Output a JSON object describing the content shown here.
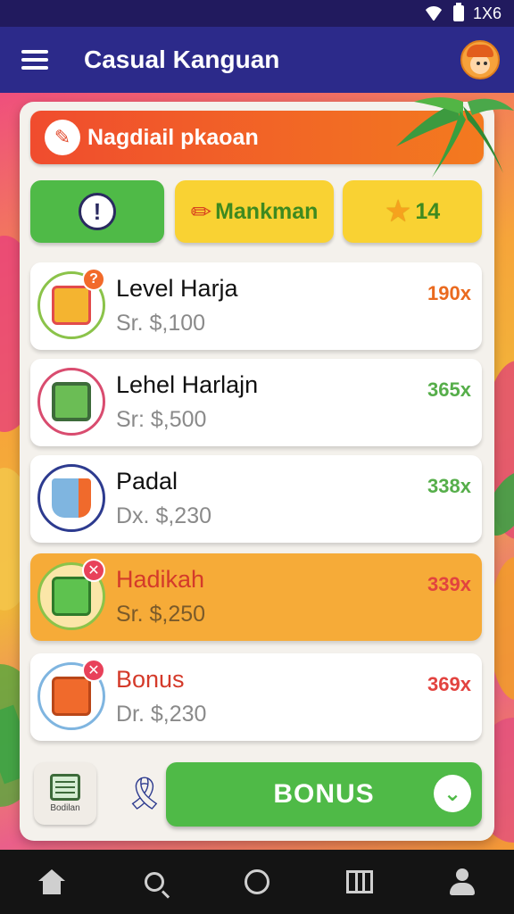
{
  "status_bar": {
    "time": "1X6"
  },
  "app_bar": {
    "title": "Casual Kanguan"
  },
  "banner": {
    "title": "Nagdiail pkaoan"
  },
  "chips": [
    {
      "icon": "alert-icon",
      "label": ""
    },
    {
      "icon": "pencil-icon",
      "label": "Mankman"
    },
    {
      "icon": "star-icon",
      "label": "14"
    }
  ],
  "items": [
    {
      "title": "Level Harja",
      "price": "Sr. $,100",
      "score": "190x",
      "icon": "frame-icon",
      "score_color": "#ea6a1f"
    },
    {
      "title": "Lehel Harlajn",
      "price": "Sr: $,500",
      "score": "365x",
      "icon": "tablet-icon",
      "score_color": "#56ae4a"
    },
    {
      "title": "Padal",
      "price": "Dx. $,230",
      "score": "338x",
      "icon": "cup-icon",
      "score_color": "#56ae4a"
    },
    {
      "title": "Hadikah",
      "price": "Sr. $,250",
      "score": "339x",
      "icon": "bag-icon",
      "score_color": "#e2433f"
    },
    {
      "title": "Bonus",
      "price": "Dr. $,230",
      "score": "369x",
      "icon": "camera-icon",
      "score_color": "#e2433f"
    }
  ],
  "bottom": {
    "schedule_label": "Bodilan",
    "bonus_label": "BONUS"
  },
  "colors": {
    "app_bar": "#2c2a8a",
    "banner": "#f04c2e",
    "accent_green": "#4fba47",
    "accent_yellow": "#f9d233",
    "highlight": "#f6ab38"
  }
}
